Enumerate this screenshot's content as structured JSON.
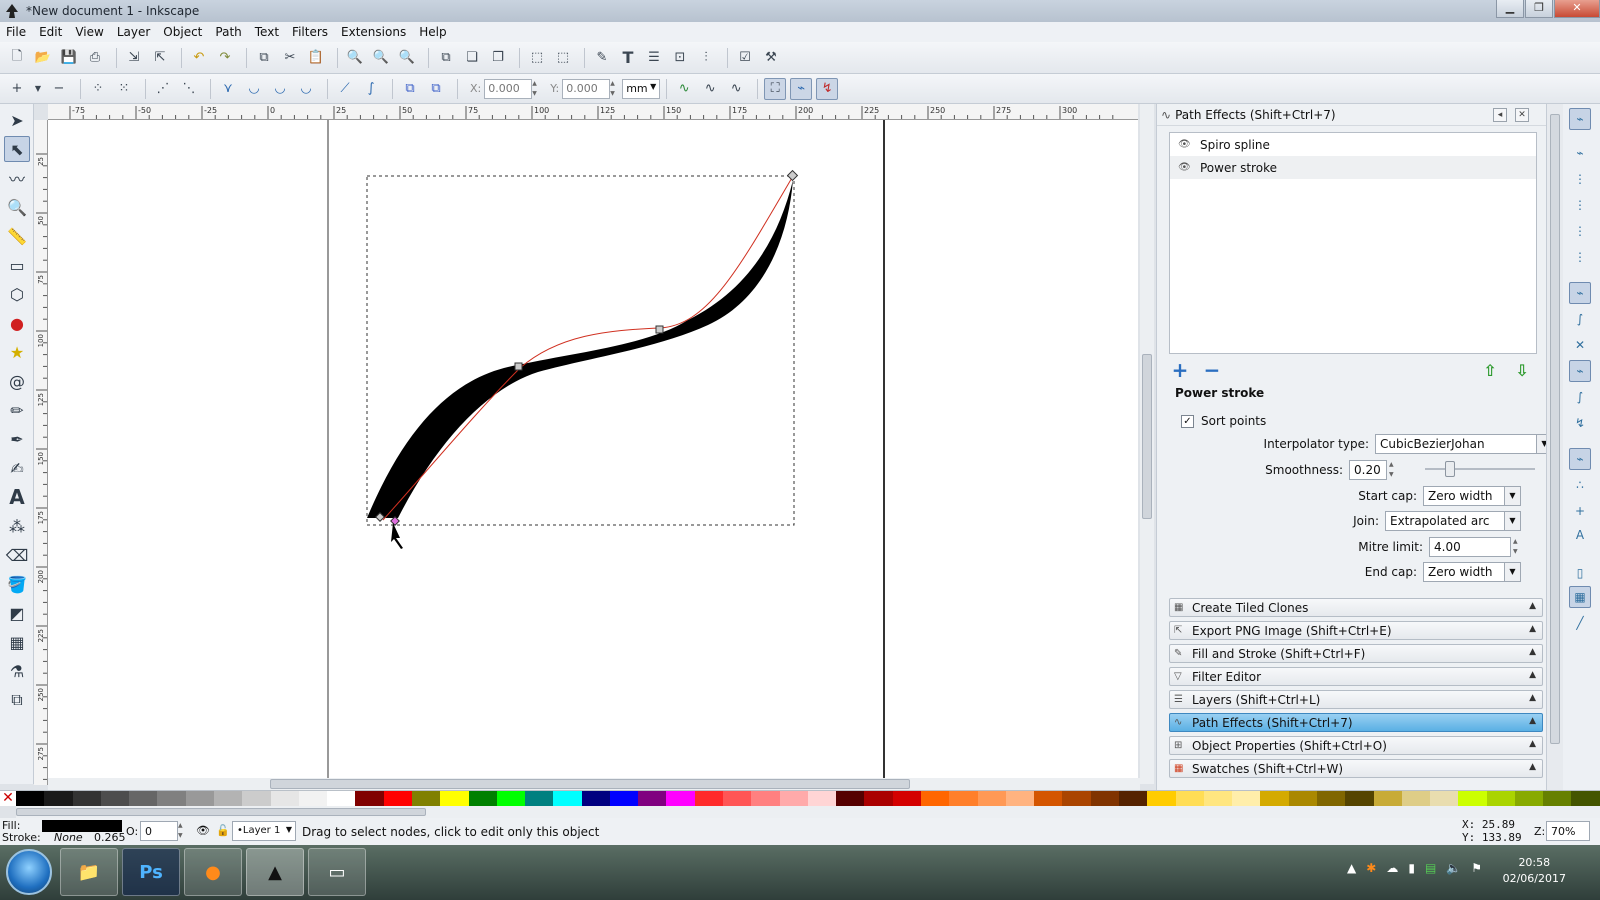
{
  "window": {
    "title": "*New document 1 - Inkscape",
    "min": "▁",
    "max": "❐",
    "close": "✕"
  },
  "menu": [
    "File",
    "Edit",
    "View",
    "Layer",
    "Object",
    "Path",
    "Text",
    "Filters",
    "Extensions",
    "Help"
  ],
  "tool_controls": {
    "x_label": "X:",
    "x_value": "0.000",
    "y_label": "Y:",
    "y_value": "0.000",
    "unit": "mm"
  },
  "rulers": {
    "h_ticks": [
      "-75",
      "-50",
      "-25",
      "0",
      "25",
      "50",
      "75",
      "100",
      "125",
      "150",
      "175",
      "200",
      "225",
      "250",
      "275",
      "300"
    ],
    "v_ticks": [
      "25",
      "50",
      "75",
      "100",
      "125",
      "150",
      "175",
      "200",
      "225",
      "250",
      "275"
    ]
  },
  "path_effects": {
    "title": "Path Effects  (Shift+Ctrl+7)",
    "effects": [
      "Spiro spline",
      "Power stroke"
    ],
    "add": "+",
    "remove": "−",
    "section_title": "Power stroke",
    "sort_points_label": "Sort points",
    "sort_points_checked": "✓",
    "interpolator_label": "Interpolator type:",
    "interpolator_value": "CubicBezierJohan",
    "smoothness_label": "Smoothness:",
    "smoothness_value": "0.20",
    "smoothness_fraction": 0.2,
    "start_cap_label": "Start cap:",
    "start_cap_value": "Zero width",
    "join_label": "Join:",
    "join_value": "Extrapolated arc",
    "mitre_label": "Mitre limit:",
    "mitre_value": "4.00",
    "end_cap_label": "End cap:",
    "end_cap_value": "Zero width"
  },
  "dialogs": [
    "Create Tiled Clones",
    "Export PNG Image (Shift+Ctrl+E)",
    "Fill and Stroke (Shift+Ctrl+F)",
    "Filter Editor",
    "Layers (Shift+Ctrl+L)",
    "Path Effects  (Shift+Ctrl+7)",
    "Object Properties (Shift+Ctrl+O)",
    "Swatches (Shift+Ctrl+W)"
  ],
  "status": {
    "fill_label": "Fill:",
    "stroke_label": "Stroke:",
    "stroke_value": "None",
    "stroke_width": "0.265",
    "opacity_label": "O:",
    "opacity_value": "0",
    "layer": "•Layer 1",
    "message": "Drag to select nodes, click to edit only this object",
    "x_coord": "X:   25.89",
    "y_coord": "Y:  133.89",
    "zoom_label": "Z:",
    "zoom_value": "70%"
  },
  "taskbar": {
    "ps_label": "Ps",
    "time": "20:58",
    "date": "02/06/2017"
  },
  "palette_colors": [
    "#000000",
    "#1a1a1a",
    "#333333",
    "#4d4d4d",
    "#666666",
    "#808080",
    "#999999",
    "#b3b3b3",
    "#cccccc",
    "#e6e6e6",
    "#f2f2f2",
    "#ffffff",
    "#800000",
    "#ff0000",
    "#808000",
    "#ffff00",
    "#008000",
    "#00ff00",
    "#008080",
    "#00ffff",
    "#000080",
    "#0000ff",
    "#800080",
    "#ff00ff",
    "#ff2a2a",
    "#ff5555",
    "#ff8080",
    "#ffaaaa",
    "#ffd5d5",
    "#550000",
    "#aa0000",
    "#d40000",
    "#ff6600",
    "#ff7f2a",
    "#ff9955",
    "#ffb380",
    "#d45500",
    "#aa4400",
    "#803300",
    "#552200",
    "#ffcc00",
    "#ffdd55",
    "#ffe680",
    "#ffeeaa",
    "#d4aa00",
    "#aa8800",
    "#806600",
    "#554400",
    "#c8ab37",
    "#decd87",
    "#e9ddaf",
    "#ccff00",
    "#aad400",
    "#88aa00",
    "#668000",
    "#445500"
  ]
}
